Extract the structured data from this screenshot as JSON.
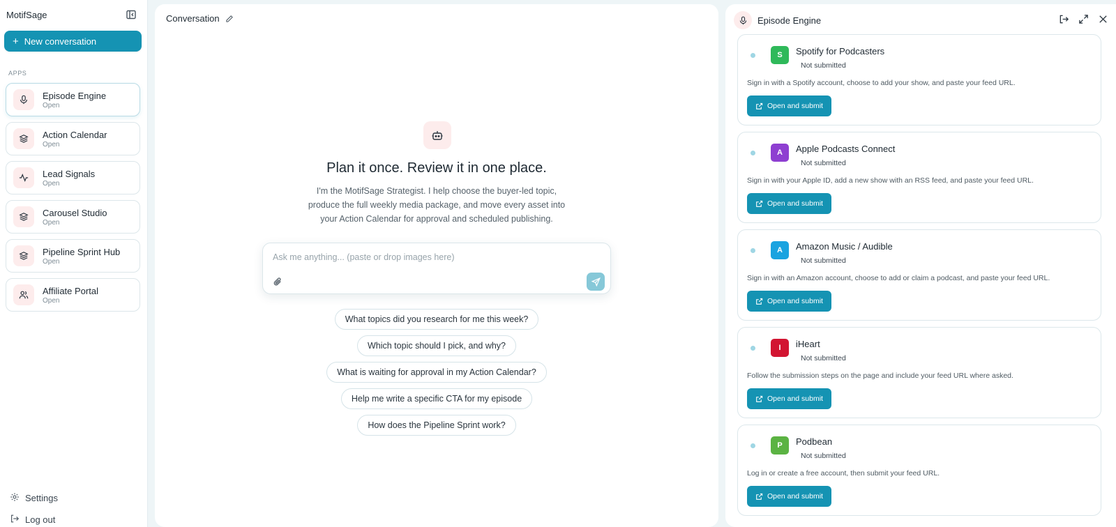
{
  "sidebar": {
    "brand": "MotifSage",
    "new_conversation": "New conversation",
    "apps_label": "APPS",
    "apps": [
      {
        "name": "Episode Engine",
        "status": "Open",
        "icon": "mic-icon"
      },
      {
        "name": "Action Calendar",
        "status": "Open",
        "icon": "layers-icon"
      },
      {
        "name": "Lead Signals",
        "status": "Open",
        "icon": "activity-icon"
      },
      {
        "name": "Carousel Studio",
        "status": "Open",
        "icon": "layers-icon"
      },
      {
        "name": "Pipeline Sprint Hub",
        "status": "Open",
        "icon": "layers-icon"
      },
      {
        "name": "Affiliate Portal",
        "status": "Open",
        "icon": "users-icon"
      }
    ],
    "settings": "Settings",
    "logout": "Log out"
  },
  "conversation": {
    "title": "Conversation",
    "hero_title": "Plan it once. Review it in one place.",
    "hero_subtitle": "I'm the MotifSage Strategist. I help choose the buyer-led topic, produce the full weekly media package, and move every asset into your Action Calendar for approval and scheduled publishing.",
    "input_placeholder": "Ask me anything... (paste or drop images here)",
    "input_value": "",
    "suggestions": [
      "What topics did you research for me this week?",
      "Which topic should I pick, and why?",
      "What is waiting for approval in my Action Calendar?",
      "Help me write a specific CTA for my episode",
      "How does the Pipeline Sprint work?"
    ]
  },
  "panel": {
    "title": "Episode Engine",
    "platforms": [
      {
        "logo": "S",
        "color": "#2fb95a",
        "name": "Spotify for Podcasters",
        "status": "Not submitted",
        "desc": "Sign in with a Spotify account, choose to add your show, and paste your feed URL.",
        "button": "Open and submit"
      },
      {
        "logo": "A",
        "color": "#8e3fd1",
        "name": "Apple Podcasts Connect",
        "status": "Not submitted",
        "desc": "Sign in with your Apple ID, add a new show with an RSS feed, and paste your feed URL.",
        "button": "Open and submit"
      },
      {
        "logo": "A",
        "color": "#1aa3e0",
        "name": "Amazon Music / Audible",
        "status": "Not submitted",
        "desc": "Sign in with an Amazon account, choose to add or claim a podcast, and paste your feed URL.",
        "button": "Open and submit"
      },
      {
        "logo": "I",
        "color": "#d21532",
        "name": "iHeart",
        "status": "Not submitted",
        "desc": "Follow the submission steps on the page and include your feed URL where asked.",
        "button": "Open and submit"
      },
      {
        "logo": "P",
        "color": "#5bb343",
        "name": "Podbean",
        "status": "Not submitted",
        "desc": "Log in or create a free account, then submit your feed URL.",
        "button": "Open and submit"
      }
    ]
  }
}
